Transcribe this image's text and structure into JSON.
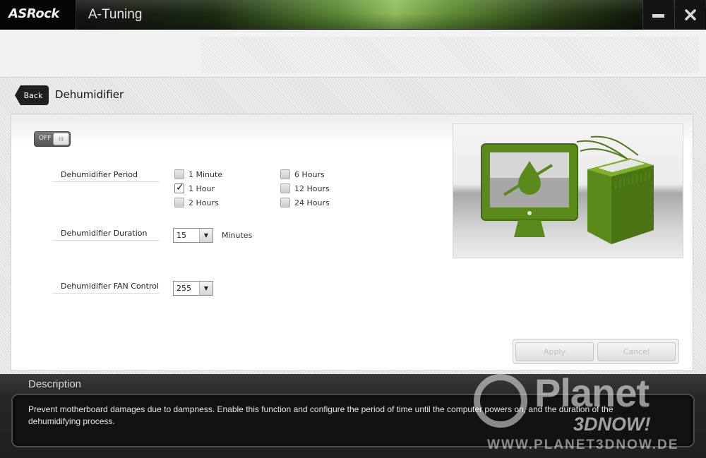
{
  "window": {
    "brand": "ASRock",
    "app_title": "A-Tuning",
    "minimize_icon": "minimize-icon",
    "close_icon": "close-icon"
  },
  "page": {
    "back_label": "Back",
    "title": "Dehumidifier"
  },
  "toggle": {
    "state_label": "OFF",
    "knob_label": "III",
    "enabled": false
  },
  "period": {
    "label": "Dehumidifier Period",
    "options": [
      {
        "label": "1 Minute",
        "checked": false
      },
      {
        "label": "1 Hour",
        "checked": true
      },
      {
        "label": "2 Hours",
        "checked": false
      },
      {
        "label": "6 Hours",
        "checked": false
      },
      {
        "label": "12 Hours",
        "checked": false
      },
      {
        "label": "24 Hours",
        "checked": false
      }
    ]
  },
  "duration": {
    "label": "Dehumidifier Duration",
    "value": "15",
    "unit": "Minutes"
  },
  "fan": {
    "label": "Dehumidifier FAN Control",
    "value": "255"
  },
  "actions": {
    "apply_label": "Apply",
    "cancel_label": "Cancel",
    "disabled": true
  },
  "description": {
    "title": "Description",
    "text": "Prevent motherboard damages due to dampness. Enable this function and configure the period of time until the computer powers on, and the duration of the dehumidifying process."
  },
  "watermark": {
    "name": "Planet",
    "sub": "3DNOW!",
    "url": "WWW.PLANET3DNOW.DE"
  },
  "colors": {
    "accent_green": "#5a8a1a",
    "dark_green": "#3f6610"
  }
}
